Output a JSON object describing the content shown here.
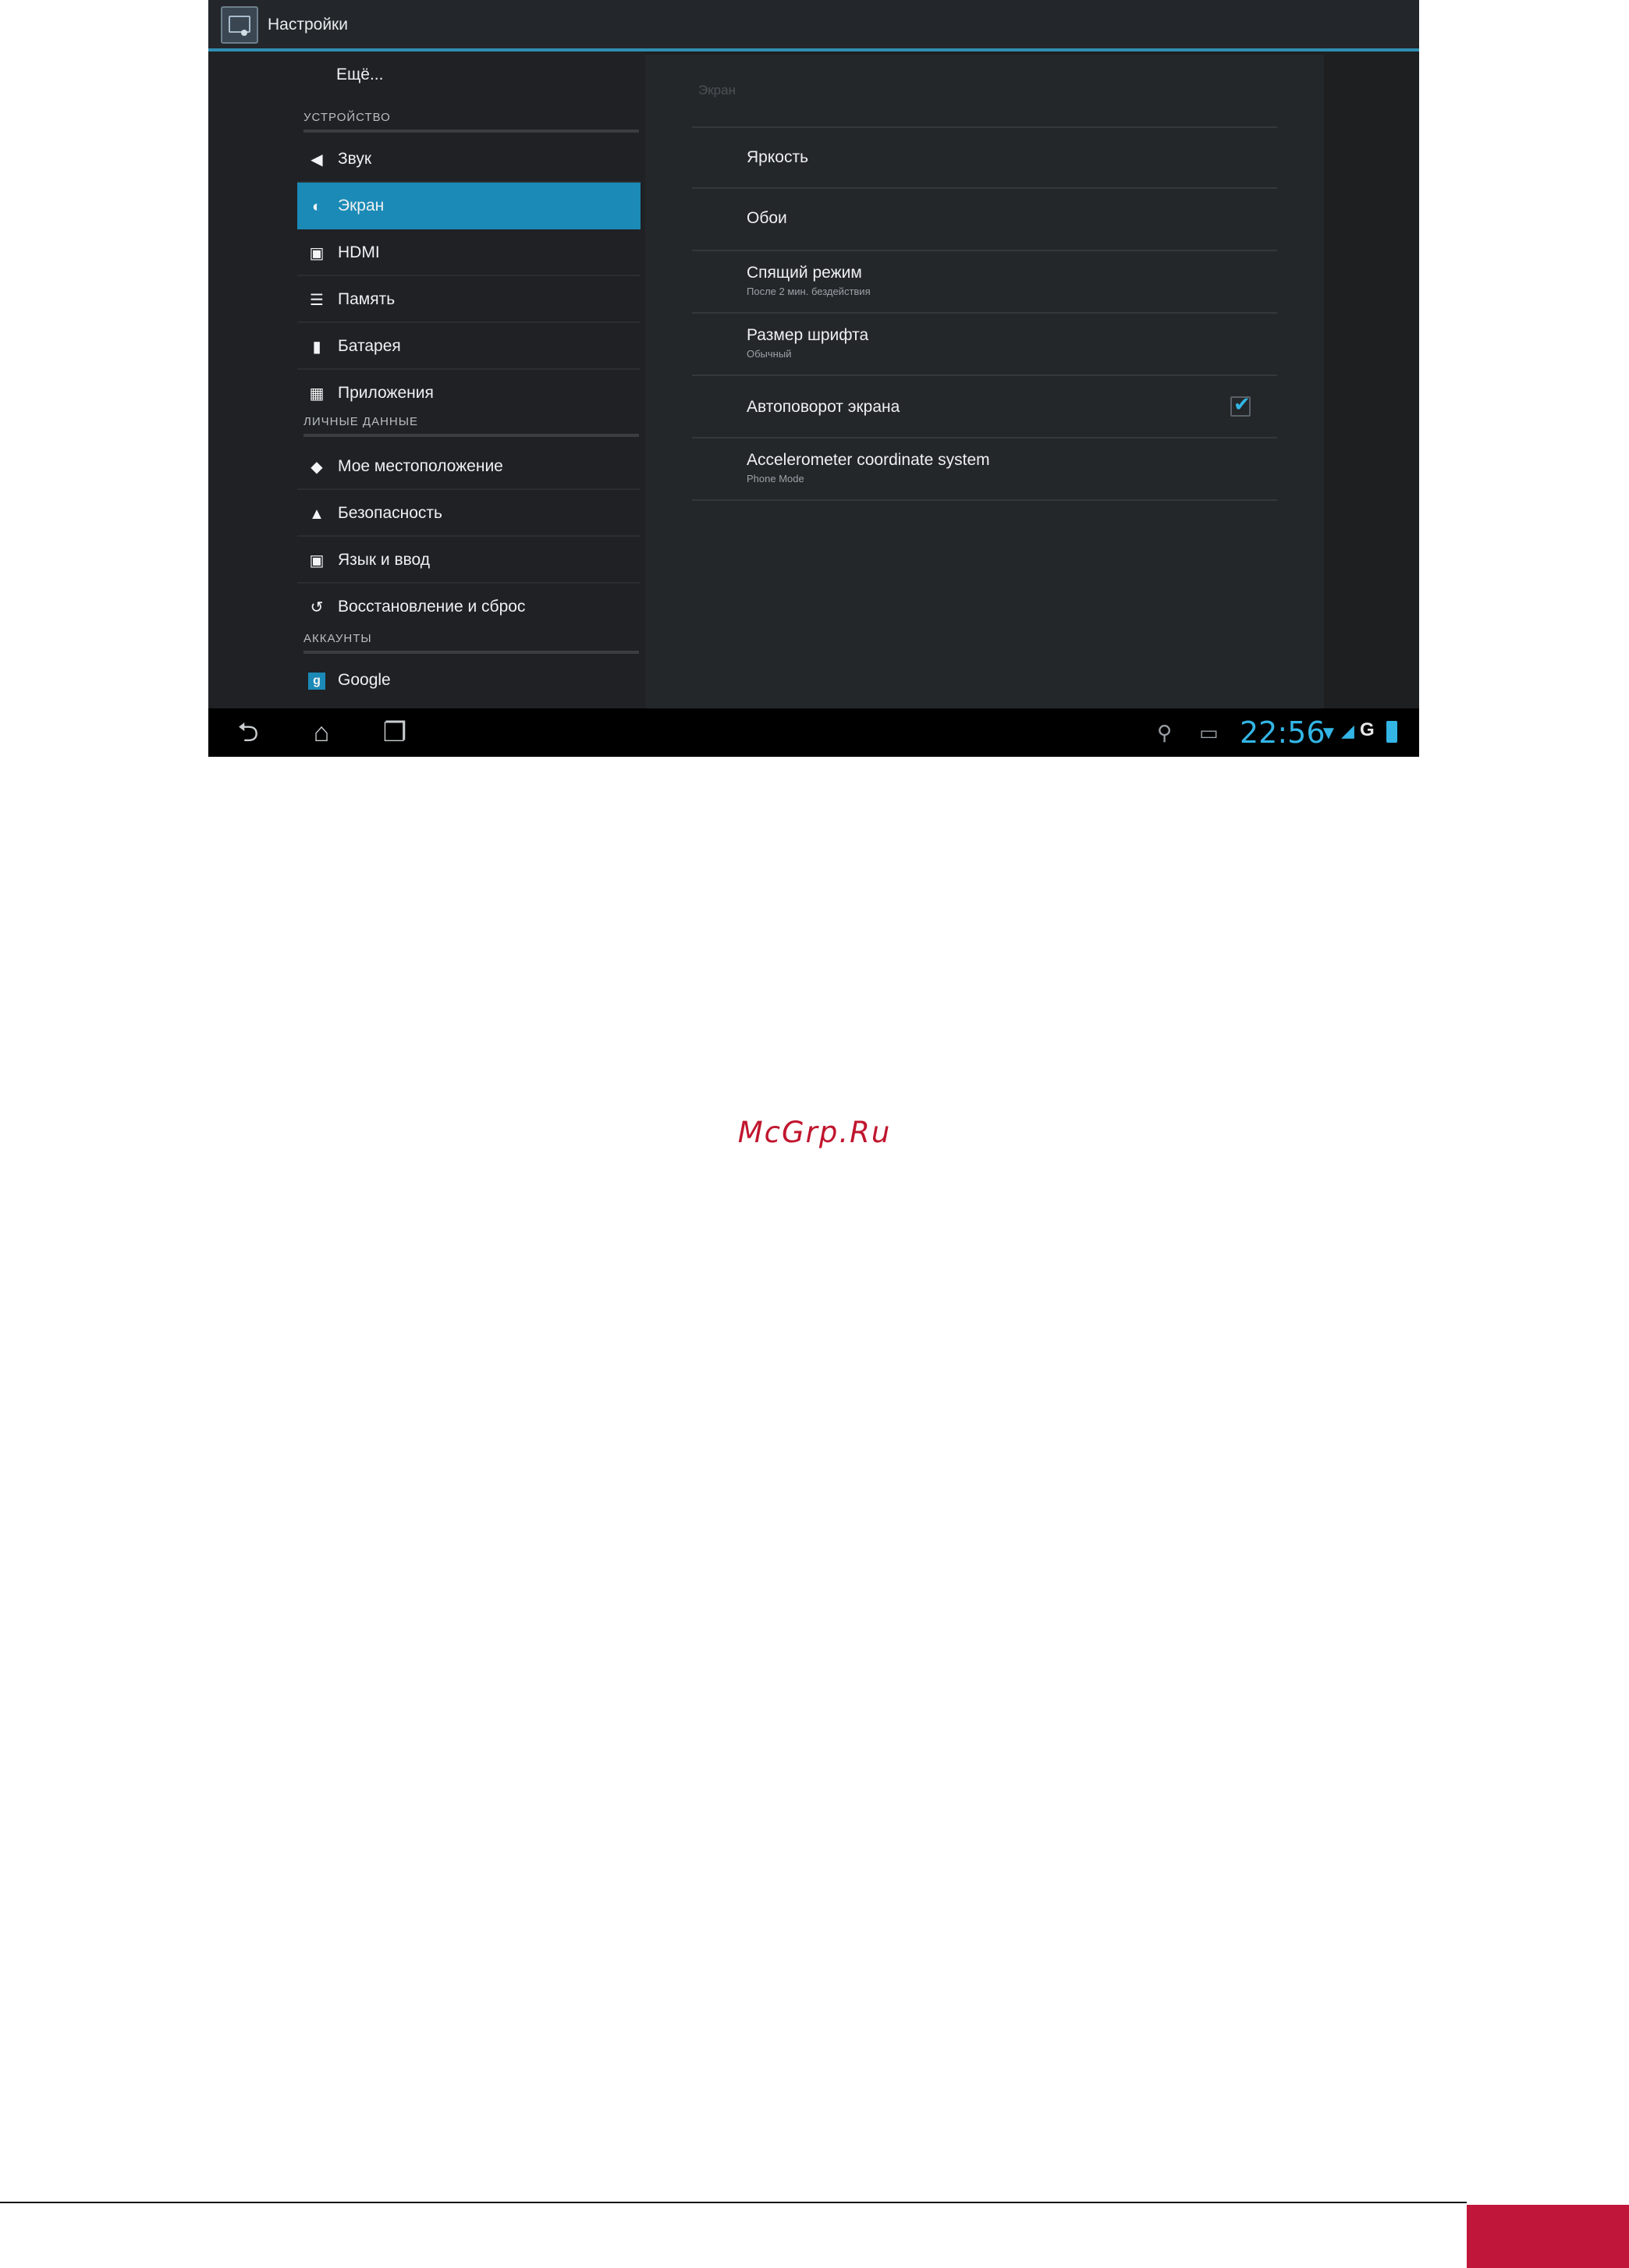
{
  "action_bar": {
    "title": "Настройки"
  },
  "left_pane": {
    "more_label": "Ещё...",
    "headers": {
      "device": "УСТРОЙСТВО",
      "personal": "ЛИЧНЫЕ ДАННЫЕ",
      "accounts": "АККАУНТЫ"
    },
    "items": [
      {
        "label": "Звук",
        "icon": "speaker-icon"
      },
      {
        "label": "Экран",
        "icon": "display-icon"
      },
      {
        "label": "HDMI",
        "icon": "hdmi-icon"
      },
      {
        "label": "Память",
        "icon": "storage-icon"
      },
      {
        "label": "Батарея",
        "icon": "battery-icon"
      },
      {
        "label": "Приложения",
        "icon": "apps-icon"
      },
      {
        "label": "Мое местоположение",
        "icon": "location-icon"
      },
      {
        "label": "Безопасность",
        "icon": "lock-icon"
      },
      {
        "label": "Язык и ввод",
        "icon": "keyboard-icon"
      },
      {
        "label": "Восстановление и сброс",
        "icon": "restore-icon"
      },
      {
        "label": "Google",
        "icon": "google-icon"
      }
    ],
    "selected": "Экран"
  },
  "right_pane": {
    "section_title": "Экран",
    "prefs": [
      {
        "title": "Яркость",
        "subtitle": ""
      },
      {
        "title": "Обои",
        "subtitle": ""
      },
      {
        "title": "Спящий режим",
        "subtitle": "После 2 мин. бездействия"
      },
      {
        "title": "Размер шрифта",
        "subtitle": "Обычный"
      },
      {
        "title": "Автоповорот экрана",
        "subtitle": "",
        "checked": true
      },
      {
        "title": "Accelerometer coordinate system",
        "subtitle": "Phone Mode"
      }
    ]
  },
  "status_bar": {
    "time": "22:56",
    "accent_color": "#33b5e5"
  },
  "watermark": "McGrp.Ru",
  "colors": {
    "selected_item": "#1b8ab7",
    "footer_block": "#c0163a",
    "watermark": "#c0162e"
  }
}
